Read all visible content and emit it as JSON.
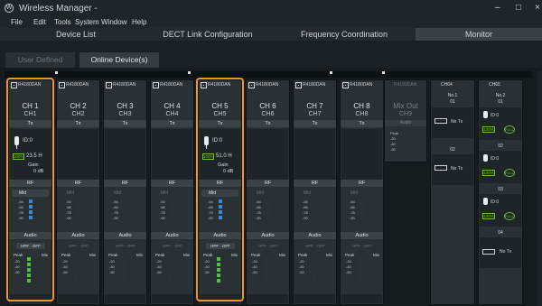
{
  "window": {
    "title": "Wireless Manager -",
    "minimize": "–",
    "maximize": "□",
    "close": "×"
  },
  "menu": [
    "File",
    "Edit",
    "Tools",
    "System",
    "Window",
    "Help"
  ],
  "tabs": [
    "Device List",
    "DECT Link Configuration",
    "Frequency Coordination",
    "Monitor"
  ],
  "active_tab": "Monitor",
  "subtabs": {
    "user_defined": "User Defined",
    "online": "Online Device(s)"
  },
  "receiver": "R4180DAN",
  "channels": [
    {
      "name": "CH 1",
      "sub": "CH1",
      "tx": "Tx",
      "id": "ID:0",
      "battery": "100%",
      "freq": "23.5 H",
      "gain_label": "Gain",
      "gain": "0 dB",
      "rf": "RF",
      "rf_mode": "Mid",
      "audio": "Audio",
      "hpf": "HPF : OFF",
      "active": true,
      "highlight": true
    },
    {
      "name": "CH 2",
      "sub": "CH2",
      "tx": "Tx",
      "rf": "RF",
      "rf_mode": "Mid",
      "audio": "Audio",
      "hpf": "HPF : OFF",
      "active": false,
      "highlight": false
    },
    {
      "name": "CH 3",
      "sub": "CH3",
      "tx": "Tx",
      "rf": "RF",
      "rf_mode": "Mid",
      "audio": "Audio",
      "hpf": "HPF : OFF",
      "active": false,
      "highlight": false
    },
    {
      "name": "CH 4",
      "sub": "CH4",
      "tx": "Tx",
      "rf": "RF",
      "rf_mode": "Mid",
      "audio": "Audio",
      "hpf": "HPF : OFF",
      "active": false,
      "highlight": false
    },
    {
      "name": "CH 5",
      "sub": "CH5",
      "tx": "Tx",
      "id": "ID:0",
      "battery": "100%",
      "freq": "51.0 H",
      "gain_label": "Gain",
      "gain": "0 dB",
      "rf": "RF",
      "rf_mode": "Mid",
      "audio": "Audio",
      "hpf": "HPF : OFF",
      "active": true,
      "highlight": true
    },
    {
      "name": "CH 6",
      "sub": "CH6",
      "tx": "Tx",
      "rf": "RF",
      "rf_mode": "Mid",
      "audio": "Audio",
      "hpf": "HPF : OFF",
      "active": false,
      "highlight": false
    },
    {
      "name": "CH 7",
      "sub": "CH7",
      "tx": "Tx",
      "rf": "RF",
      "rf_mode": "Mid",
      "audio": "Audio",
      "hpf": "HPF : OFF",
      "active": false,
      "highlight": false
    },
    {
      "name": "CH 8",
      "sub": "CH8",
      "tx": "Tx",
      "rf": "RF",
      "rf_mode": "Mid",
      "audio": "Audio",
      "hpf": "HPF : OFF",
      "active": false,
      "highlight": false
    }
  ],
  "rf_ticks": [
    "-54",
    "-66",
    "-78",
    "-90"
  ],
  "audio_ticks": [
    "Peak",
    "-20",
    "-40",
    "-50"
  ],
  "mix_label": "Mix",
  "mixout": {
    "name": "Mix Out",
    "sub": "CH9",
    "audio": "Audio"
  },
  "side_units": [
    {
      "name": "CH64",
      "slots": [
        {
          "no": "No.1",
          "ch": "01",
          "state": "No Tx"
        },
        {
          "no": "",
          "ch": "02",
          "state": "No Tx"
        }
      ]
    },
    {
      "name": "CH65",
      "slots": [
        {
          "no": "No.2",
          "ch": "01",
          "id": "ID:0",
          "battery": "100%",
          "status": "FULL"
        },
        {
          "ch": "02",
          "id": "ID:0",
          "battery": "100%",
          "status": "FULL"
        },
        {
          "ch": "03",
          "id": "ID:0",
          "battery": "100%",
          "status": "FULL"
        },
        {
          "ch": "04",
          "state": "No Tx"
        }
      ]
    }
  ],
  "colors": {
    "accent": "#f0952e",
    "battery": "#6ac23a",
    "meter": "#3b8ad8"
  }
}
